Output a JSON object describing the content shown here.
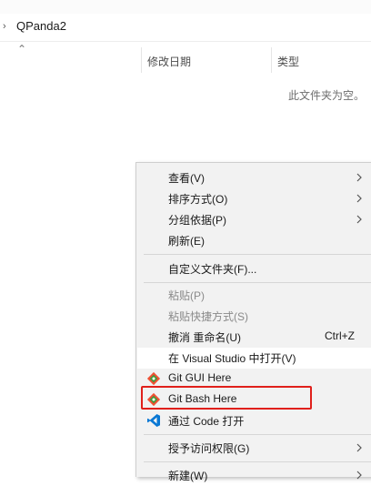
{
  "address_bar": {
    "path": "QPanda2"
  },
  "columns": [
    {
      "label": "修改日期"
    },
    {
      "label": "类型"
    }
  ],
  "empty_message": "此文件夹为空。",
  "context_menu": {
    "items": {
      "view": {
        "label": "查看(V)",
        "submenu": true
      },
      "sort": {
        "label": "排序方式(O)",
        "submenu": true
      },
      "group": {
        "label": "分组依据(P)",
        "submenu": true
      },
      "refresh": {
        "label": "刷新(E)"
      },
      "customize": {
        "label": "自定义文件夹(F)..."
      },
      "paste": {
        "label": "粘贴(P)",
        "disabled": true
      },
      "paste_shortcut": {
        "label": "粘贴快捷方式(S)",
        "disabled": true
      },
      "undo_rename": {
        "label": "撤消 重命名(U)",
        "shortcut": "Ctrl+Z"
      },
      "open_vs": {
        "label": "在 Visual Studio 中打开(V)"
      },
      "git_gui": {
        "label": "Git GUI Here",
        "icon": "git-gui-icon"
      },
      "git_bash": {
        "label": "Git Bash Here",
        "icon": "git-bash-icon"
      },
      "vscode": {
        "label": "通过 Code 打开",
        "icon": "vscode-icon"
      },
      "grant_access": {
        "label": "授予访问权限(G)",
        "submenu": true
      },
      "new": {
        "label": "新建(W)",
        "submenu": true
      }
    }
  },
  "colors": {
    "highlight_border": "#e0201b",
    "git_orange": "#f05033",
    "vscode_blue": "#0a78d4"
  }
}
